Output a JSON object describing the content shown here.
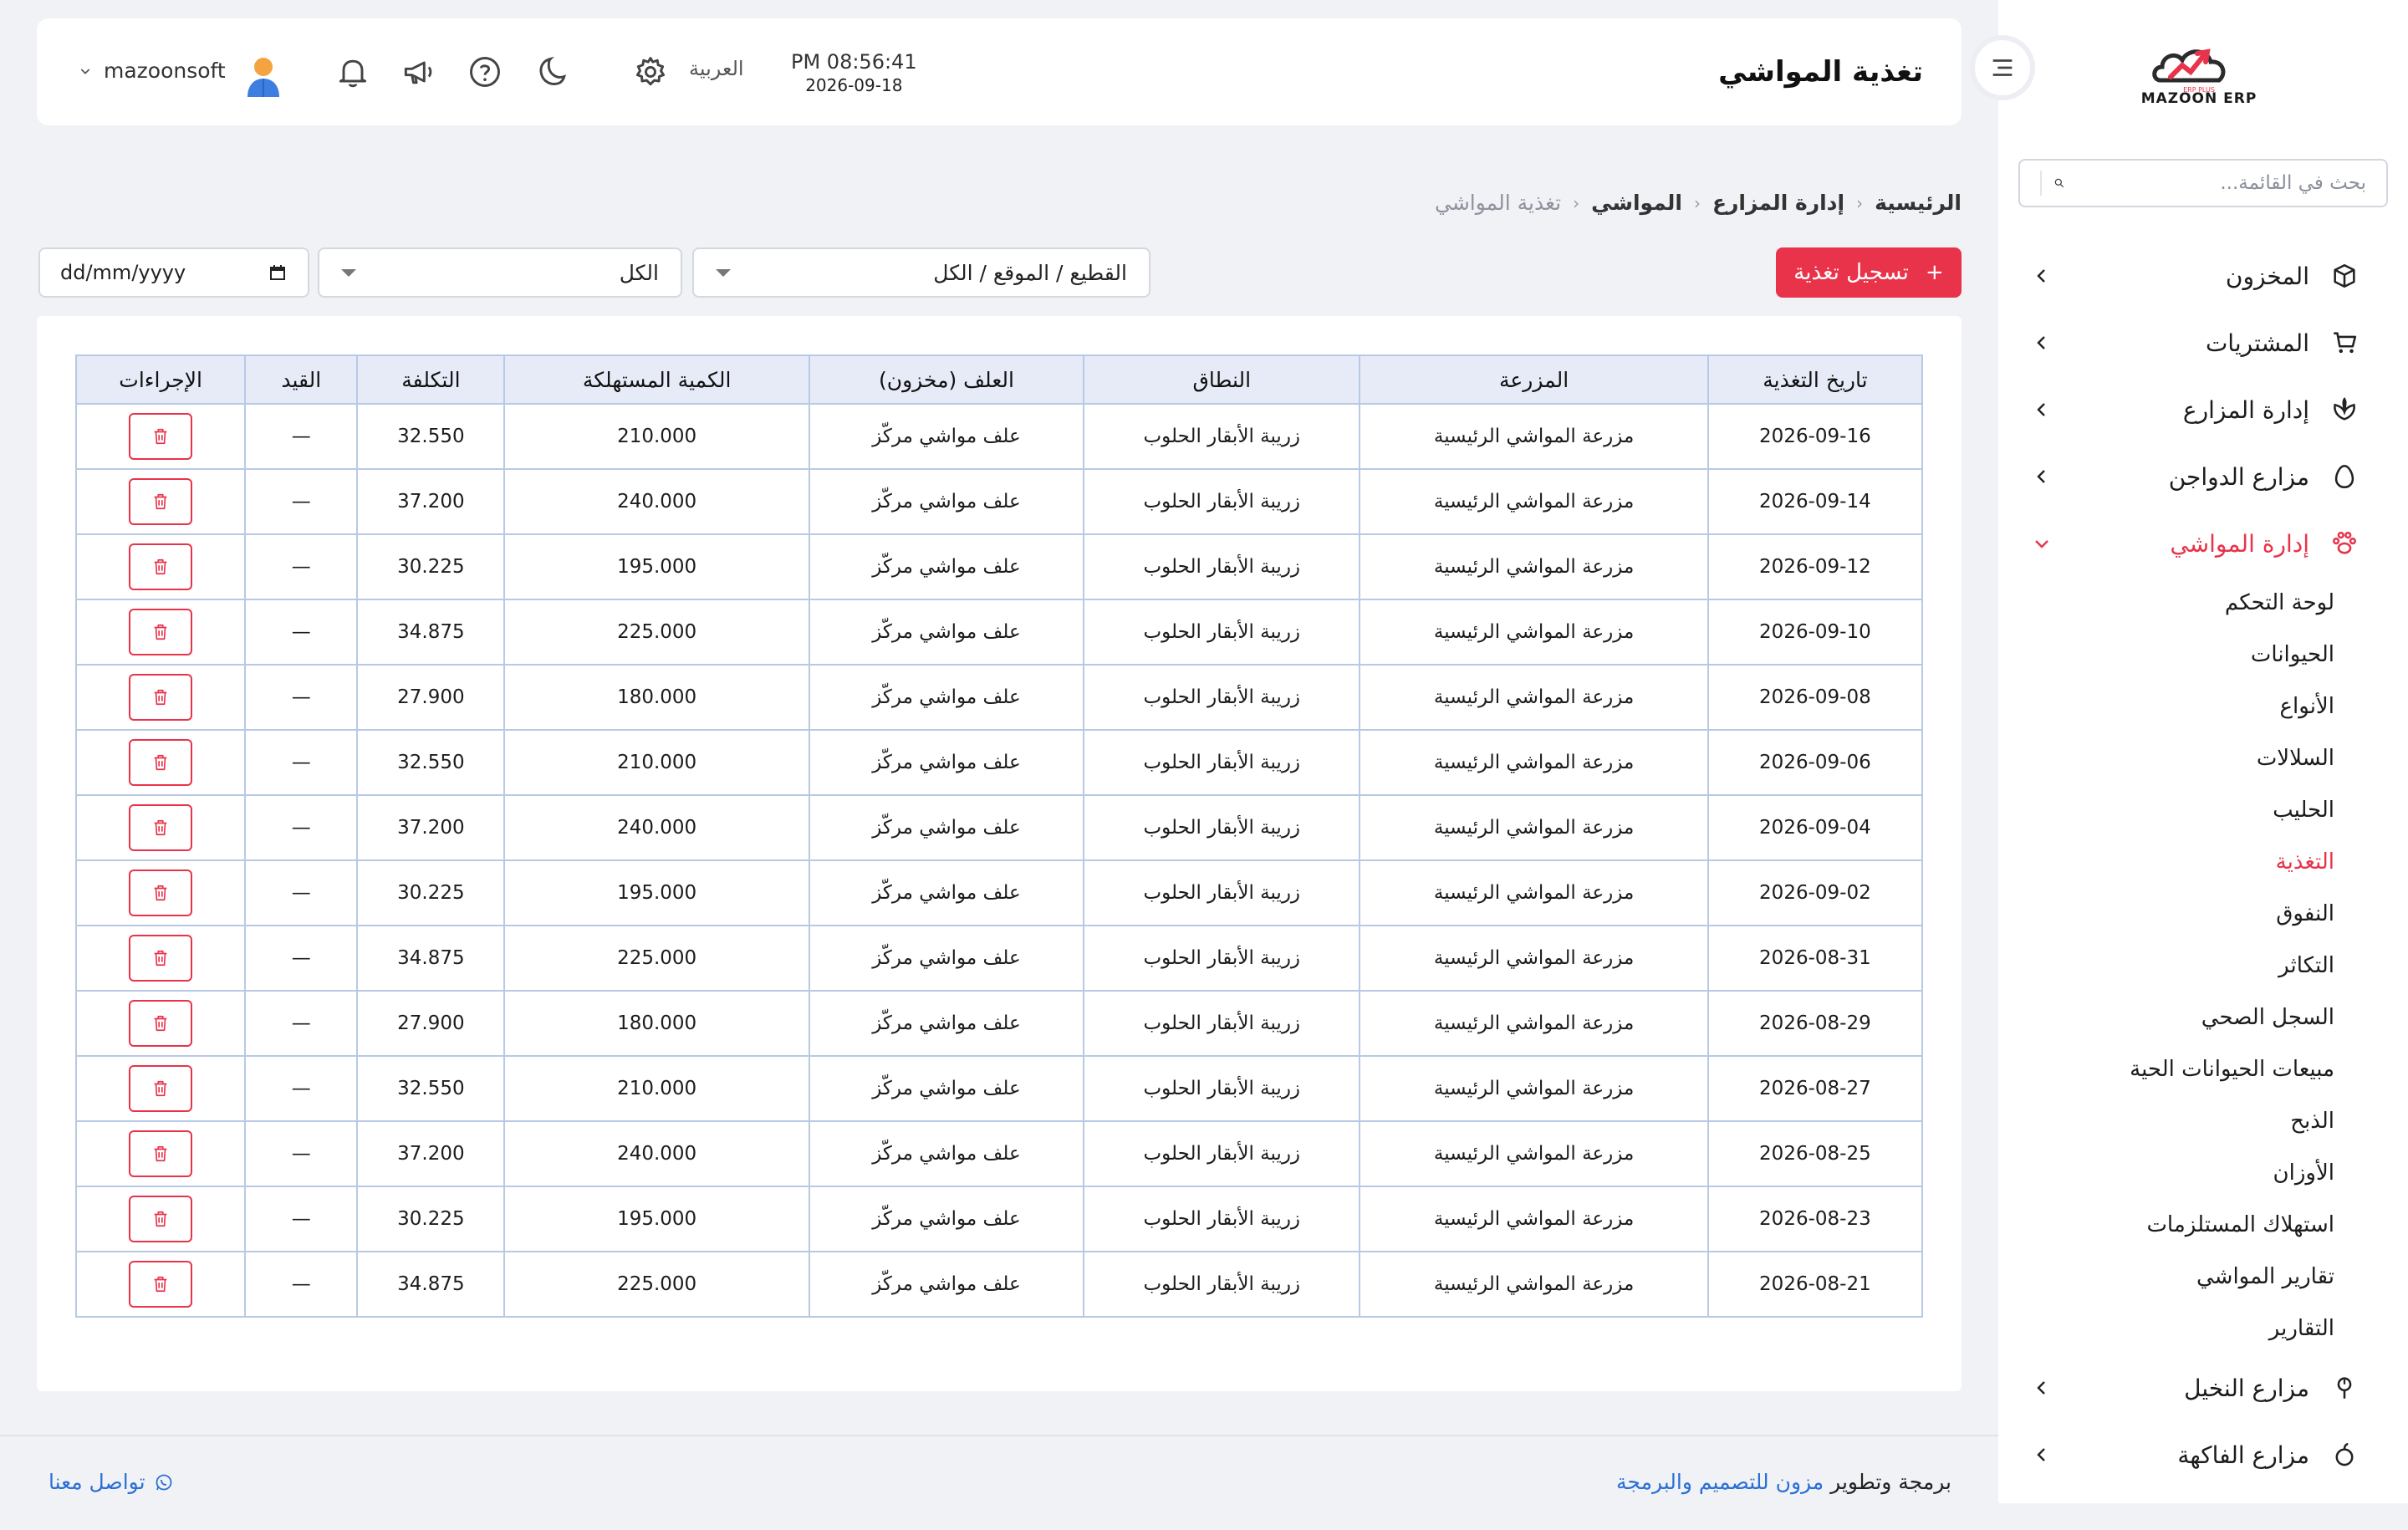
{
  "brand": {
    "name": "MAZOON ERP",
    "tagline": "ERP PLUS"
  },
  "colors": {
    "accent": "#e8334a",
    "link": "#2a6fd6",
    "table_border": "#b8c9e6",
    "table_head": "#e7ebf7"
  },
  "sidebar": {
    "search_placeholder": "بحث في القائمة...",
    "items": [
      {
        "label": "المخزون",
        "icon": "box-icon"
      },
      {
        "label": "المشتريات",
        "icon": "cart-icon"
      },
      {
        "label": "إدارة المزارع",
        "icon": "leaf-icon"
      },
      {
        "label": "مزارع الدواجن",
        "icon": "egg-icon"
      },
      {
        "label": "إدارة المواشي",
        "icon": "paw-icon",
        "active": true
      }
    ],
    "sub_items": [
      "لوحة التحكم",
      "الحيوانات",
      "الأنواع",
      "السلالات",
      "الحليب",
      "التغذية",
      "النفوق",
      "التكاثر",
      "السجل الصحي",
      "مبيعات الحيوانات الحية",
      "الذبح",
      "الأوزان",
      "استهلاك المستلزمات",
      "تقارير المواشي",
      "التقارير"
    ],
    "active_sub": "التغذية",
    "bottom_items": [
      {
        "label": "مزارع النخيل",
        "icon": "palm-icon"
      },
      {
        "label": "مزارع الفاكهة",
        "icon": "fruit-icon"
      }
    ]
  },
  "header": {
    "title": "تغذية المواشي",
    "time": "PM 08:56:41",
    "date": "2026-09-18",
    "language": "العربية",
    "username": "mazoonsoft"
  },
  "breadcrumb": [
    "الرئيسية",
    "إدارة المزارع",
    "المواشي",
    "تغذية المواشي"
  ],
  "toolbar": {
    "add_button": "تسجيل تغذية",
    "herd_filter": "القطيع / الموقع / الكل",
    "scope_filter": "الكل",
    "date_placeholder": "dd/mm/yyyy"
  },
  "table": {
    "headers": [
      "تاريخ التغذية",
      "المزرعة",
      "النطاق",
      "العلف (مخزون)",
      "الكمية المستهلكة",
      "التكلفة",
      "القيد",
      "الإجراءات"
    ],
    "rows": [
      [
        "2026-09-16",
        "مزرعة المواشي الرئيسية",
        "زريبة الأبقار الحلوب",
        "علف مواشي مركّز",
        "210.000",
        "32.550",
        "—"
      ],
      [
        "2026-09-14",
        "مزرعة المواشي الرئيسية",
        "زريبة الأبقار الحلوب",
        "علف مواشي مركّز",
        "240.000",
        "37.200",
        "—"
      ],
      [
        "2026-09-12",
        "مزرعة المواشي الرئيسية",
        "زريبة الأبقار الحلوب",
        "علف مواشي مركّز",
        "195.000",
        "30.225",
        "—"
      ],
      [
        "2026-09-10",
        "مزرعة المواشي الرئيسية",
        "زريبة الأبقار الحلوب",
        "علف مواشي مركّز",
        "225.000",
        "34.875",
        "—"
      ],
      [
        "2026-09-08",
        "مزرعة المواشي الرئيسية",
        "زريبة الأبقار الحلوب",
        "علف مواشي مركّز",
        "180.000",
        "27.900",
        "—"
      ],
      [
        "2026-09-06",
        "مزرعة المواشي الرئيسية",
        "زريبة الأبقار الحلوب",
        "علف مواشي مركّز",
        "210.000",
        "32.550",
        "—"
      ],
      [
        "2026-09-04",
        "مزرعة المواشي الرئيسية",
        "زريبة الأبقار الحلوب",
        "علف مواشي مركّز",
        "240.000",
        "37.200",
        "—"
      ],
      [
        "2026-09-02",
        "مزرعة المواشي الرئيسية",
        "زريبة الأبقار الحلوب",
        "علف مواشي مركّز",
        "195.000",
        "30.225",
        "—"
      ],
      [
        "2026-08-31",
        "مزرعة المواشي الرئيسية",
        "زريبة الأبقار الحلوب",
        "علف مواشي مركّز",
        "225.000",
        "34.875",
        "—"
      ],
      [
        "2026-08-29",
        "مزرعة المواشي الرئيسية",
        "زريبة الأبقار الحلوب",
        "علف مواشي مركّز",
        "180.000",
        "27.900",
        "—"
      ],
      [
        "2026-08-27",
        "مزرعة المواشي الرئيسية",
        "زريبة الأبقار الحلوب",
        "علف مواشي مركّز",
        "210.000",
        "32.550",
        "—"
      ],
      [
        "2026-08-25",
        "مزرعة المواشي الرئيسية",
        "زريبة الأبقار الحلوب",
        "علف مواشي مركّز",
        "240.000",
        "37.200",
        "—"
      ],
      [
        "2026-08-23",
        "مزرعة المواشي الرئيسية",
        "زريبة الأبقار الحلوب",
        "علف مواشي مركّز",
        "195.000",
        "30.225",
        "—"
      ],
      [
        "2026-08-21",
        "مزرعة المواشي الرئيسية",
        "زريبة الأبقار الحلوب",
        "علف مواشي مركّز",
        "225.000",
        "34.875",
        "—"
      ]
    ]
  },
  "footer": {
    "credit_prefix": "برمجة وتطوير",
    "credit_link": "مزون للتصميم والبرمجة",
    "contact": "تواصل معنا"
  }
}
